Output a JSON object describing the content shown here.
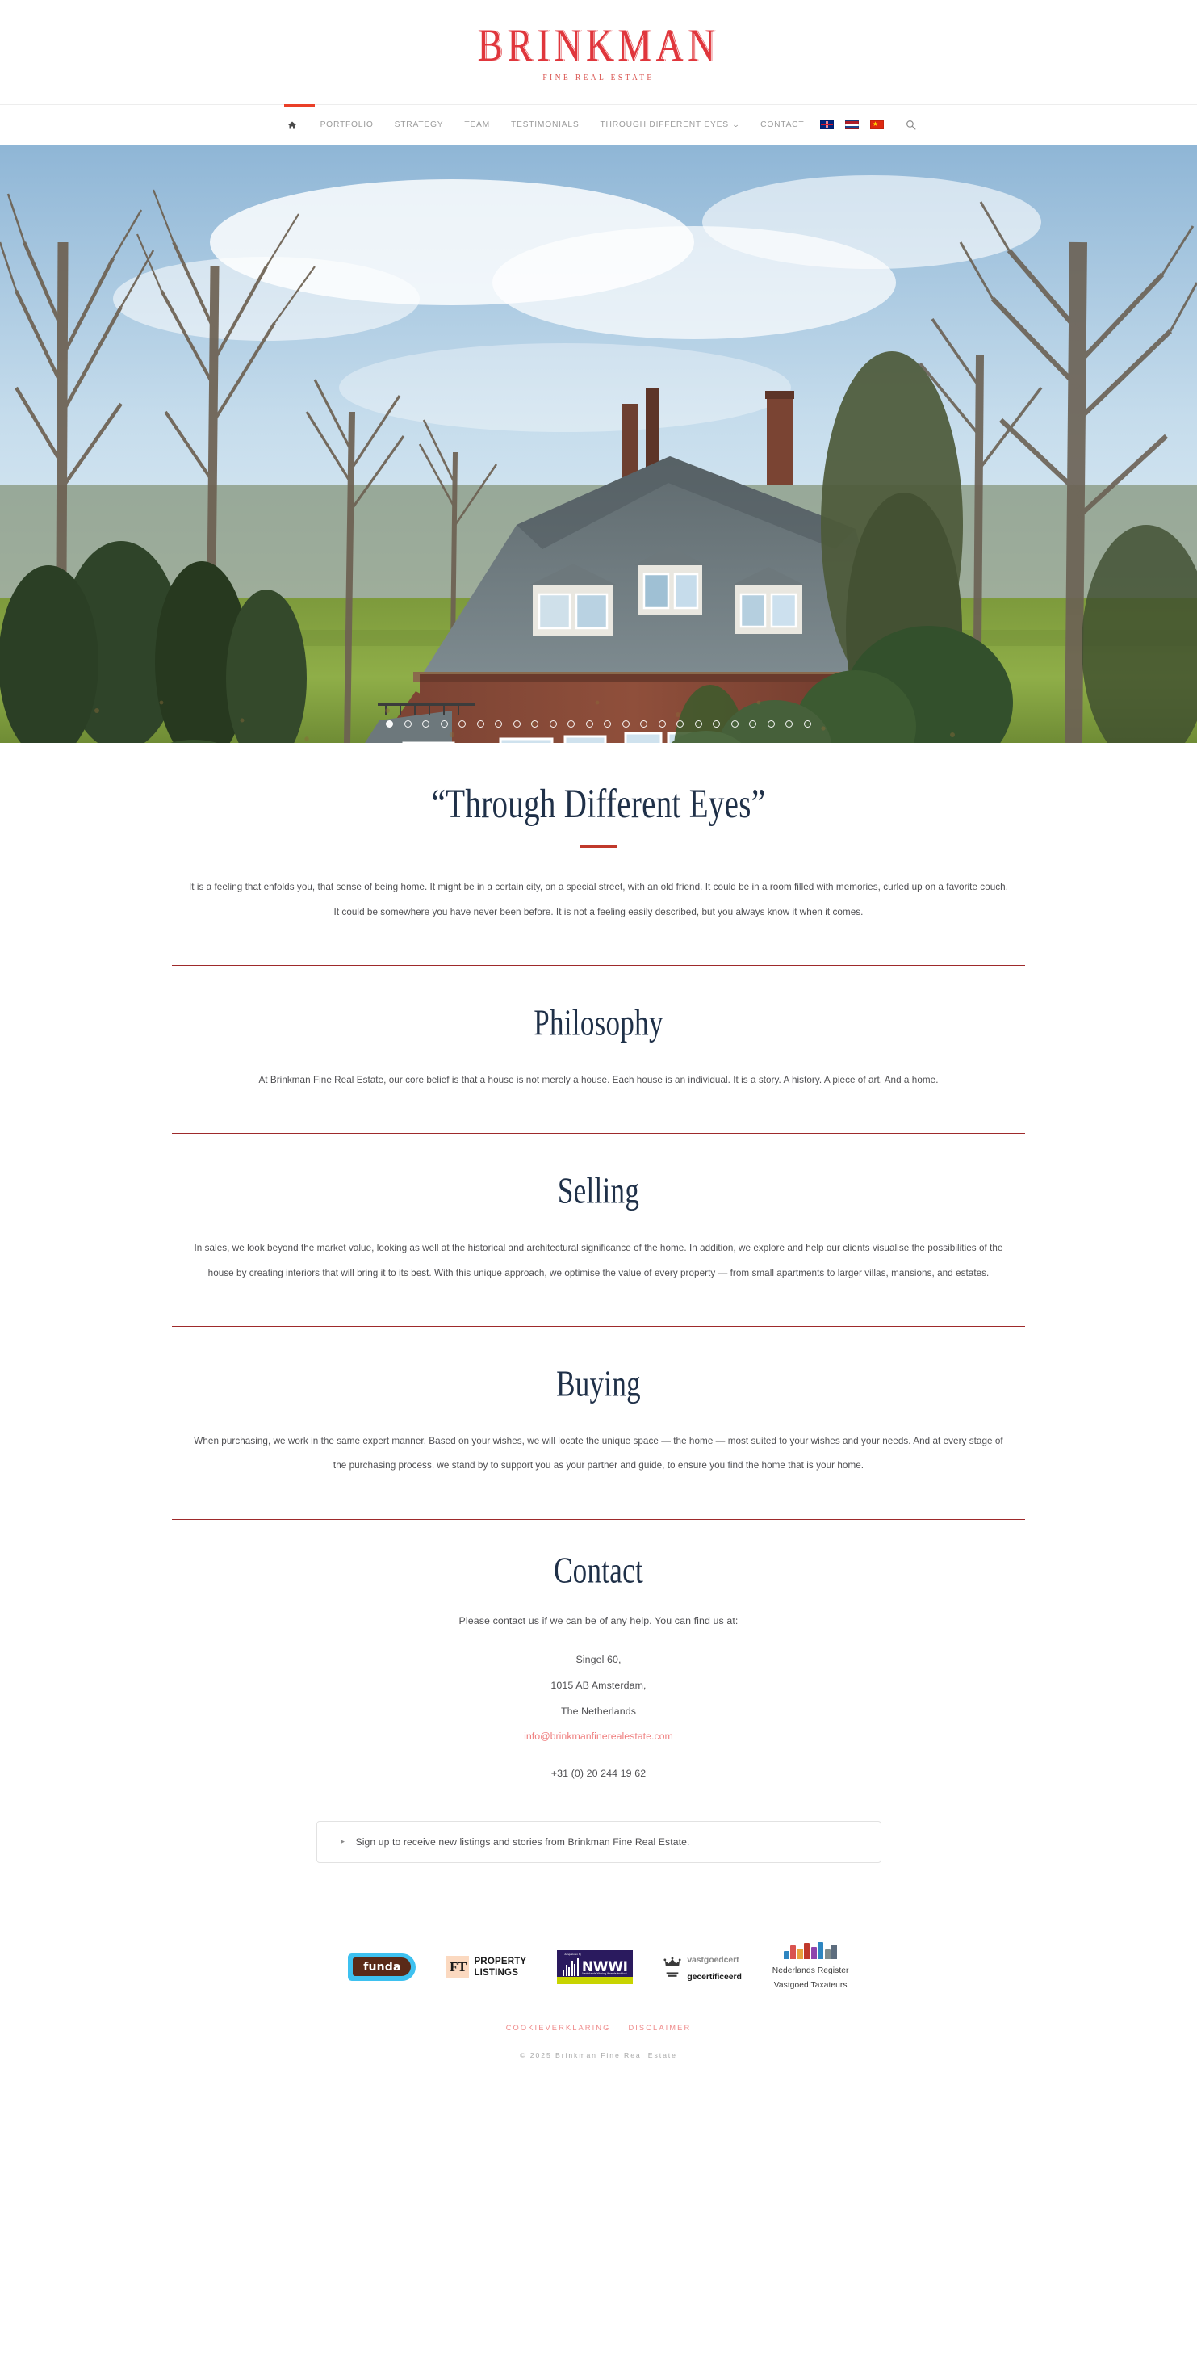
{
  "brand": {
    "name": "BRINKMAN",
    "tagline": "FINE REAL ESTATE",
    "accent_red": "#e0363c",
    "nav_accent": "#ea3f28",
    "heading_navy": "#1f3048",
    "rule_red": "#9e2a2b",
    "link_pink": "#ef7f7f"
  },
  "nav": {
    "home_label": "Home",
    "items": [
      {
        "label": "PORTFOLIO",
        "has_caret": false
      },
      {
        "label": "STRATEGY",
        "has_caret": false
      },
      {
        "label": "TEAM",
        "has_caret": false
      },
      {
        "label": "TESTIMONIALS",
        "has_caret": false
      },
      {
        "label": "THROUGH DIFFERENT EYES",
        "has_caret": true
      },
      {
        "label": "CONTACT",
        "has_caret": false
      }
    ],
    "caret_glyph": "⌄",
    "languages": [
      {
        "code": "en",
        "name": "English"
      },
      {
        "code": "nl",
        "name": "Nederlands"
      },
      {
        "code": "zh",
        "name": "中文"
      }
    ],
    "search_label": "Search"
  },
  "hero": {
    "alt": "Brick villa with slate roof set in a wooded garden",
    "slide_count": 24,
    "active_slide": 1
  },
  "sections": [
    {
      "id": "through-different-eyes",
      "title": "“Through Different Eyes”",
      "has_underline": true,
      "body": "It is a feeling that enfolds you, that sense of being home. It might be in a certain city, on a special street, with an old friend. It could be in a room filled with memories, curled up on a favorite couch. It could be somewhere you have never been before. It is not a feeling easily described, but you always know it when it comes."
    },
    {
      "id": "philosophy",
      "title": "Philosophy",
      "has_underline": false,
      "body": "At Brinkman Fine Real Estate, our core belief  is that a house is not merely a house. Each house is an individual. It is a story. A history. A piece of art. And a home."
    },
    {
      "id": "selling",
      "title": "Selling",
      "has_underline": false,
      "body": "In sales, we look beyond the market value, looking as well at the historical and architectural significance of the home. In addition, we explore and help our clients visualise the possibilities of the house by creating interiors that will bring it to its best. With this unique approach, we optimise the value of every property — from small apartments to larger villas, mansions, and estates."
    },
    {
      "id": "buying",
      "title": "Buying",
      "has_underline": false,
      "body": "When purchasing, we work in the same expert manner. Based on your wishes, we will locate the unique space — the home — most suited to your wishes and your needs. And at every stage of the purchasing process, we stand by to support you as your partner and guide, to ensure you find the home that is your home."
    }
  ],
  "contact": {
    "title": "Contact",
    "intro": "Please contact us if we can be of any help. You can find us at:",
    "address_lines": [
      "Singel 60,",
      "1015 AB Amsterdam,",
      "The Netherlands"
    ],
    "email": "info@brinkmanfinerealestate.com",
    "phone": "+31 (0) 20 244 19 62"
  },
  "newsletter": {
    "items": [
      "Sign up to receive new listings and stories from Brinkman Fine Real Estate."
    ]
  },
  "footer": {
    "partners": [
      {
        "id": "funda",
        "text": "funda"
      },
      {
        "id": "ft-property-listings",
        "mark": "FT",
        "line1": "PROPERTY",
        "line2": "LISTINGS"
      },
      {
        "id": "nwwi",
        "text": "NWWI",
        "tag": "Aangesloten bij",
        "sub": "Nederlands Woning Waarde Instituut"
      },
      {
        "id": "vastgoedcert",
        "line1a": "vastgoed",
        "line1b": "cert",
        "line2": "gecertificeerd"
      },
      {
        "id": "nrvt",
        "line1": "Nederlands Register",
        "line2": "Vastgoed Taxateurs"
      }
    ],
    "links": [
      "COOKIEVERKLARING",
      "DISCLAIMER"
    ],
    "copyright": "© 2025 Brinkman Fine Real Estate"
  }
}
